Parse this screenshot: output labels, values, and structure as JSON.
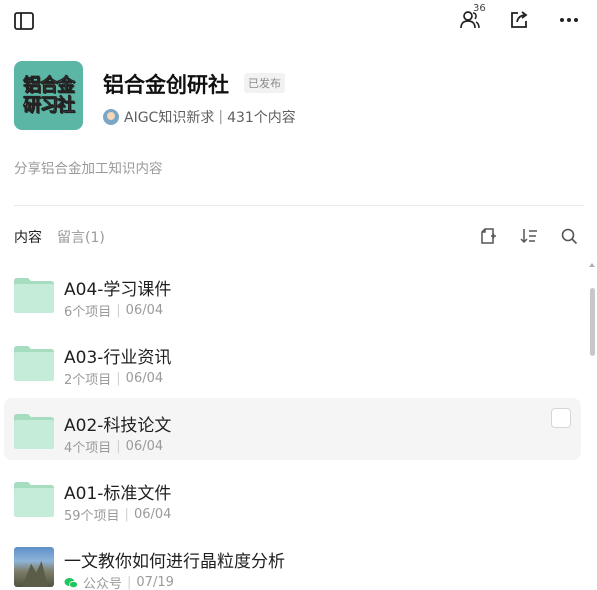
{
  "topbar": {
    "members_count": "36",
    "icons": [
      "sidebar-toggle-icon",
      "members-icon",
      "share-icon",
      "more-icon"
    ]
  },
  "header": {
    "logo_lines": [
      "铝合金",
      "研习社"
    ],
    "title": "铝合金创研社",
    "published_badge": "已发布",
    "owner_name": "AIGC知识新求",
    "content_count": "431个内容"
  },
  "description": "分享铝合金加工知识内容",
  "tabs": [
    {
      "label": "内容",
      "active": true
    },
    {
      "label": "留言(1)",
      "active": false
    }
  ],
  "toolbar_icons": [
    "new-doc-icon",
    "sort-icon",
    "search-icon"
  ],
  "items": [
    {
      "title": "A04-学习课件",
      "count": "6个项目",
      "date": "06/04",
      "type": "folder"
    },
    {
      "title": "A03-行业资讯",
      "count": "2个项目",
      "date": "06/04",
      "type": "folder"
    },
    {
      "title": "A02-科技论文",
      "count": "4个项目",
      "date": "06/04",
      "type": "folder"
    },
    {
      "title": "A01-标准文件",
      "count": "59个项目",
      "date": "06/04",
      "type": "folder"
    },
    {
      "title": "一文教你如何进行晶粒度分析",
      "count": "公众号",
      "date": "07/19",
      "type": "article"
    }
  ],
  "colors": {
    "folder": "#b9e6cf",
    "folder_tab": "#a6dcc0",
    "logo_bg": "#5cb6a5",
    "wechat": "#22c55e"
  }
}
